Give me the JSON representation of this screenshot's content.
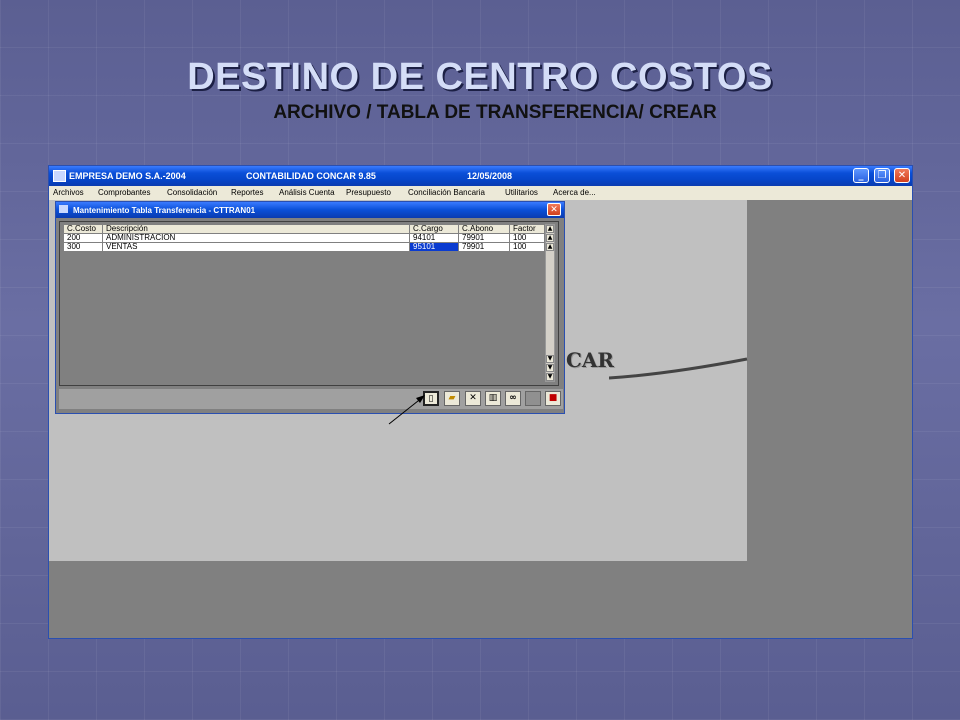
{
  "slide": {
    "title": "DESTINO DE CENTRO COSTOS",
    "subtitle": "ARCHIVO / TABLA DE TRANSFERENCIA/ CREAR"
  },
  "app": {
    "company": "EMPRESA DEMO S.A.-2004",
    "program": "CONTABILIDAD CONCAR 9.85",
    "date": "12/05/2008",
    "menu": [
      "Archivos",
      "Comprobantes",
      "Consolidación",
      "Reportes",
      "Análisis Cuenta",
      "Presupuesto",
      "Conciliación Bancaria",
      "Utilitarios",
      "Acerca de..."
    ],
    "background_logo_text": "CAR"
  },
  "child_window": {
    "title": "Mantenimiento Tabla Transferencia - CTTRAN01",
    "table": {
      "headers": [
        "C.Costo",
        "Descripción",
        "C.Cargo",
        "C.Abono",
        "Factor"
      ],
      "rows": [
        [
          "200",
          "ADMINISTRACION",
          "94101",
          "79901",
          "100"
        ],
        [
          "300",
          "VENTAS",
          "95101",
          "79901",
          "100"
        ]
      ],
      "selected_cell": {
        "row": 1,
        "col": 2
      }
    },
    "toolbar_icons": [
      "new-document-icon",
      "open-folder-icon",
      "delete-x-icon",
      "book-icon",
      "binoculars-icon",
      "blank-icon",
      "exit-door-icon"
    ]
  },
  "colors": {
    "titlebar": "#0a4fd8",
    "selection": "#0a3bd0",
    "slide_title": "#d4ddf7"
  }
}
